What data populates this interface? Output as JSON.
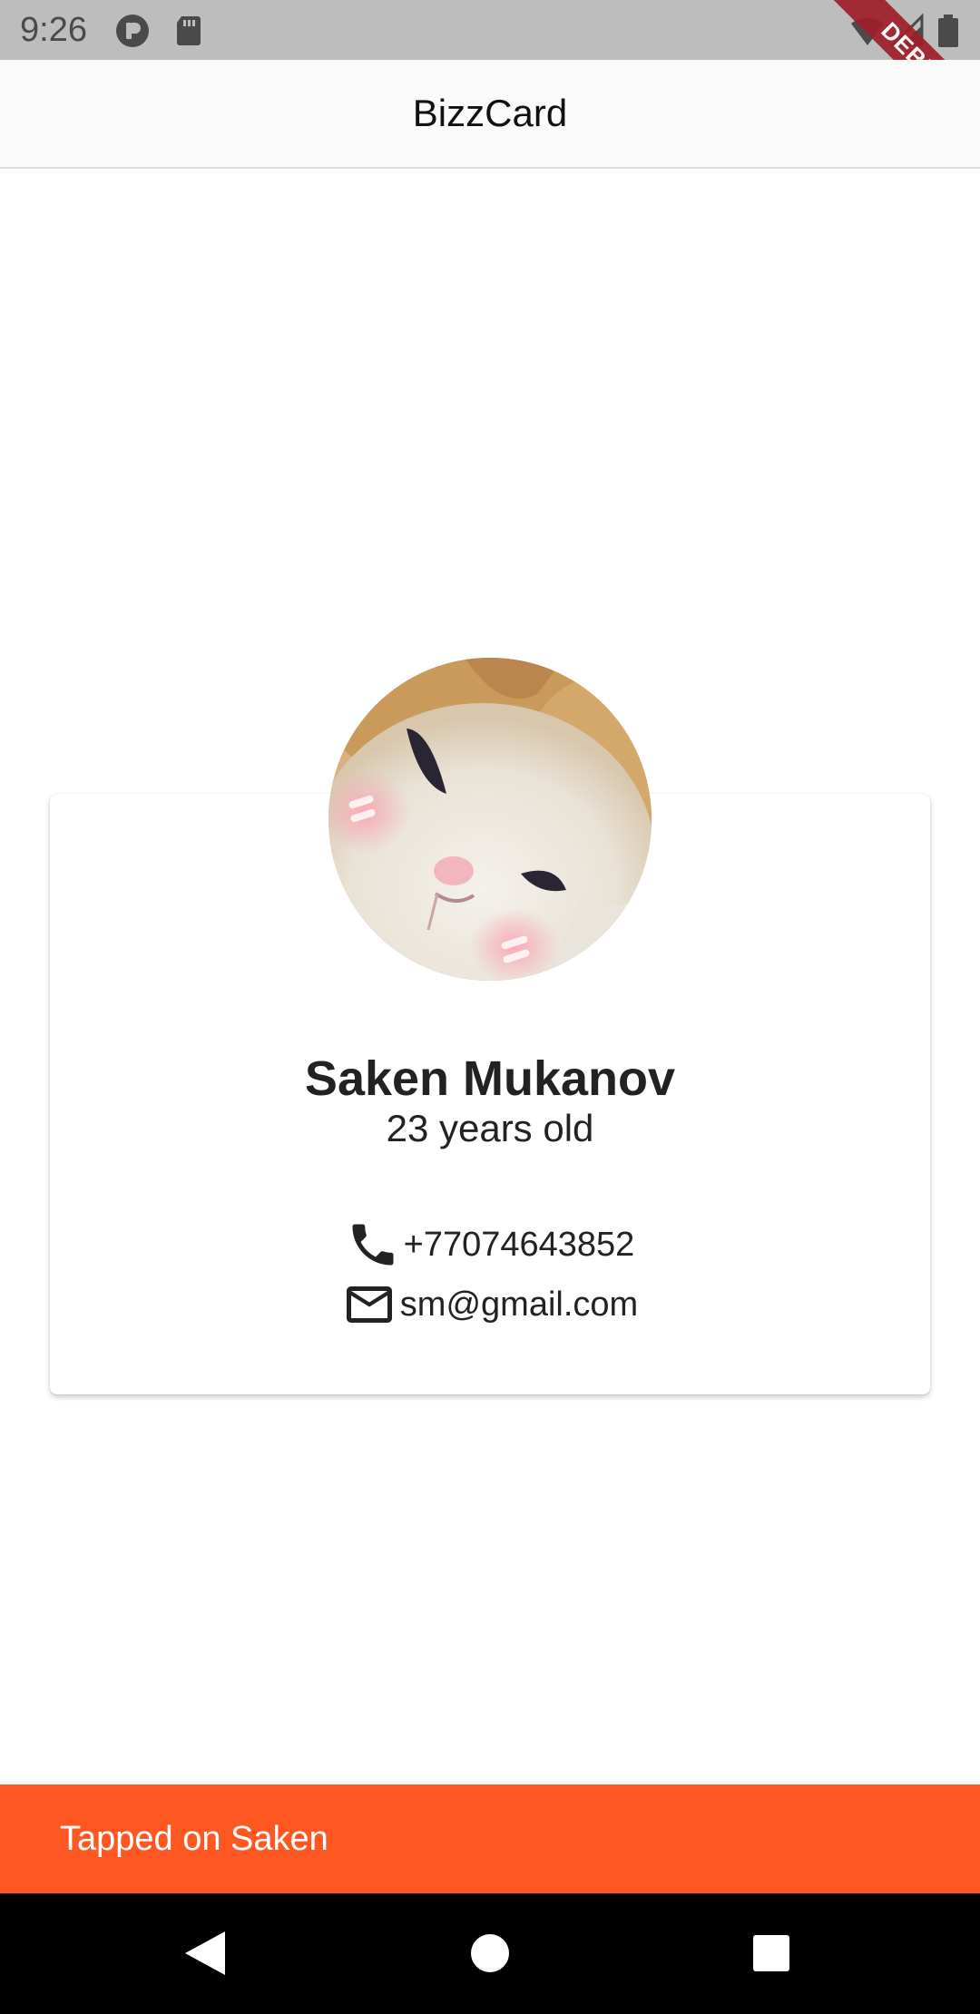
{
  "status_bar": {
    "time": "9:26",
    "icons_left": [
      "notification-app-icon",
      "sd-card-icon"
    ],
    "icons_right": [
      "wifi-icon",
      "signal-icon",
      "battery-icon"
    ],
    "debug_label": "DEBUG"
  },
  "app_bar": {
    "title": "BizzCard"
  },
  "card": {
    "avatar": "cat-avatar-image",
    "name": "Saken Mukanov",
    "age": "23 years old",
    "phone": "+77074643852",
    "email": "sm@gmail.com"
  },
  "snackbar": {
    "text": "Tapped on Saken",
    "color": "#FE5722"
  },
  "nav_bar": {
    "buttons": [
      "back-icon",
      "home-icon",
      "recents-icon"
    ]
  }
}
